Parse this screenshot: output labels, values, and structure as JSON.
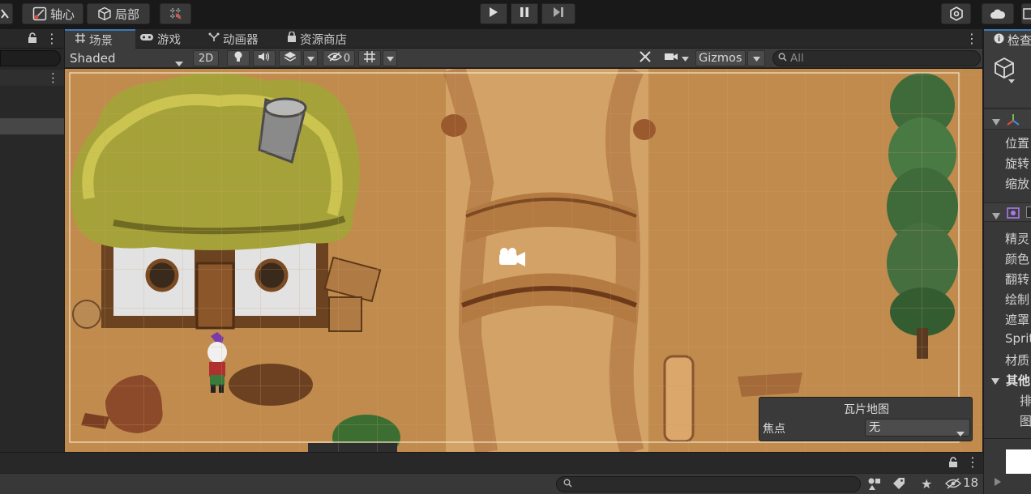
{
  "toolbar": {
    "pivot_label": "轴心",
    "local_label": "局部"
  },
  "scene_tabs": [
    {
      "label": "场景"
    },
    {
      "label": "游戏"
    },
    {
      "label": "动画器"
    },
    {
      "label": "资源商店"
    }
  ],
  "scene_toolbar": {
    "shading_mode": "Shaded",
    "mode_2d": "2D",
    "hidden_count": "0",
    "gizmos_label": "Gizmos",
    "search_placeholder": "All"
  },
  "tile_overlay": {
    "title": "瓦片地图",
    "focus_label": "焦点",
    "focus_value": "无"
  },
  "inspector": {
    "tab_label": "检查",
    "transform_rows": [
      "位置",
      "旋转",
      "缩放"
    ],
    "sprite_rows": [
      "精灵",
      "颜色",
      "翻转",
      "绘制",
      "遮罩",
      "Sprit",
      "材质"
    ],
    "other_section": "其他",
    "other_rows": [
      "排",
      "图"
    ]
  },
  "bottom_bar": {
    "hidden_count": "18"
  },
  "colors": {
    "accent": "#3a79bb",
    "ground": "#c08a4c",
    "panel": "#383838",
    "panel_dark": "#282828"
  }
}
